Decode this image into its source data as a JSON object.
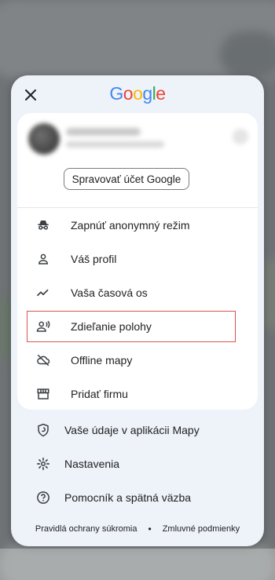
{
  "header": {
    "logo_letters": [
      "G",
      "o",
      "o",
      "g",
      "l",
      "e"
    ],
    "logo_colors": [
      "#4285F4",
      "#EA4335",
      "#FBBC05",
      "#4285F4",
      "#34A853",
      "#EA4335"
    ]
  },
  "account": {
    "manage_label": "Spravovať účet Google"
  },
  "menu": {
    "items": [
      {
        "label": "Zapnúť anonymný režim",
        "icon": "incognito-icon"
      },
      {
        "label": "Váš profil",
        "icon": "person-icon"
      },
      {
        "label": "Vaša časová os",
        "icon": "timeline-icon"
      },
      {
        "label": "Zdieľanie polohy",
        "icon": "location-sharing-icon"
      },
      {
        "label": "Offline mapy",
        "icon": "offline-cloud-icon"
      },
      {
        "label": "Pridať firmu",
        "icon": "storefront-icon"
      }
    ]
  },
  "secondary": {
    "items": [
      {
        "label": "Vaše údaje v aplikácii Mapy",
        "icon": "shield-icon"
      },
      {
        "label": "Nastavenia",
        "icon": "gear-icon"
      },
      {
        "label": "Pomocník a spätná väzba",
        "icon": "help-icon"
      }
    ]
  },
  "footer": {
    "privacy": "Pravidlá ochrany súkromia",
    "separator": "•",
    "terms": "Zmluvné podmienky"
  },
  "colors": {
    "highlight": "#d9534f",
    "sheet_bg": "#eef2f9"
  }
}
